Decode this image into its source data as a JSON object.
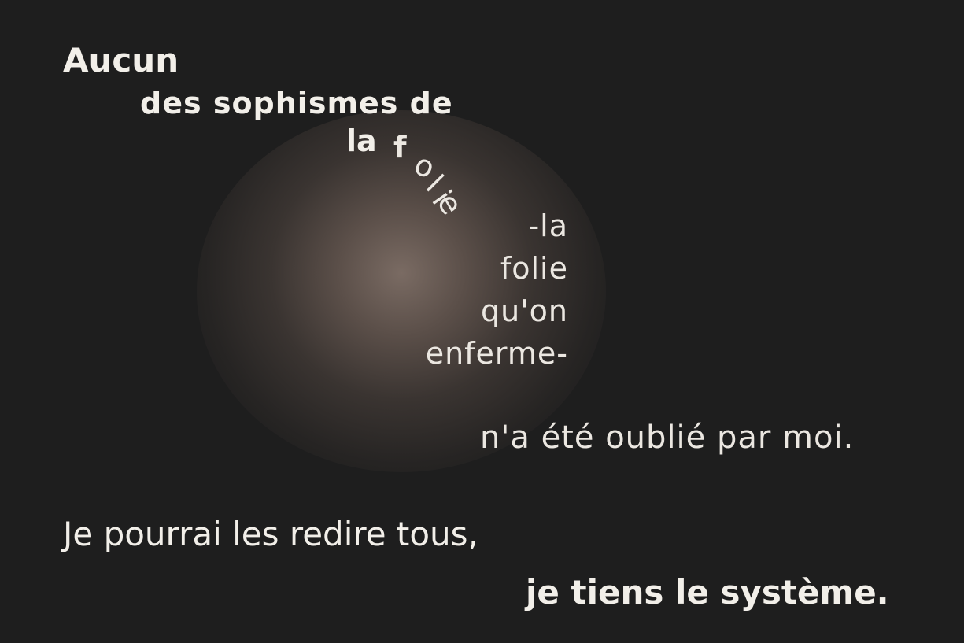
{
  "poem": {
    "line1": "Aucun",
    "line2": "des sophismes de",
    "line3_start": "la ",
    "line3_letters": [
      "f",
      "o",
      "l",
      "i",
      "e"
    ],
    "line4": "-la",
    "line5": "folie",
    "line6": "qu'on",
    "line7": "enferme-",
    "line8": "n'a été oublié par moi.",
    "line9": "Je pourrai les redire tous,",
    "line10": "je tiens le système."
  },
  "colors": {
    "background": "#1e1e1e",
    "text": "#f2efe9",
    "glow": "#7a6b63"
  }
}
